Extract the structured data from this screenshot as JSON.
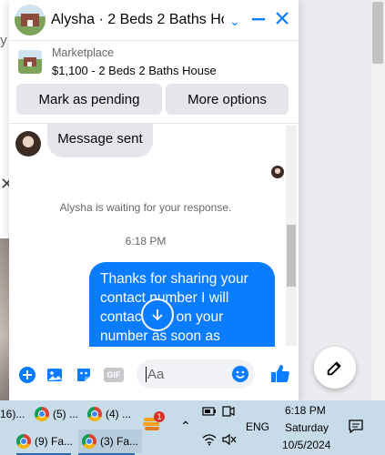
{
  "background": {
    "left_cut_text": "ty"
  },
  "chat": {
    "title": "Alysha · 2 Beds 2 Baths Ho...",
    "listing": {
      "category": "Marketplace",
      "title": "$1,100 - 2 Beds 2 Baths House"
    },
    "actions": {
      "mark_pending": "Mark as pending",
      "more_options": "More options"
    },
    "messages": {
      "incoming_text": "Message sent",
      "status": "Alysha is waiting for your response.",
      "timestamp": "6:18 PM",
      "outgoing_text": "Thanks for sharing your contact number I will contact you on your number as soon as possible"
    },
    "composer": {
      "placeholder": "Aa",
      "gif_label": "GIF"
    },
    "accent_color": "#0a7cff"
  },
  "taskbar": {
    "items": [
      {
        "label": "16)..."
      },
      {
        "label": "(5) ..."
      },
      {
        "label": "(4) ..."
      },
      {
        "label": "(9) Fa..."
      },
      {
        "label": "(3) Fa..."
      }
    ],
    "notification_badge": "1",
    "language": "ENG",
    "clock": {
      "time": "6:18 PM",
      "day": "Saturday",
      "date": "10/5/2024"
    }
  }
}
